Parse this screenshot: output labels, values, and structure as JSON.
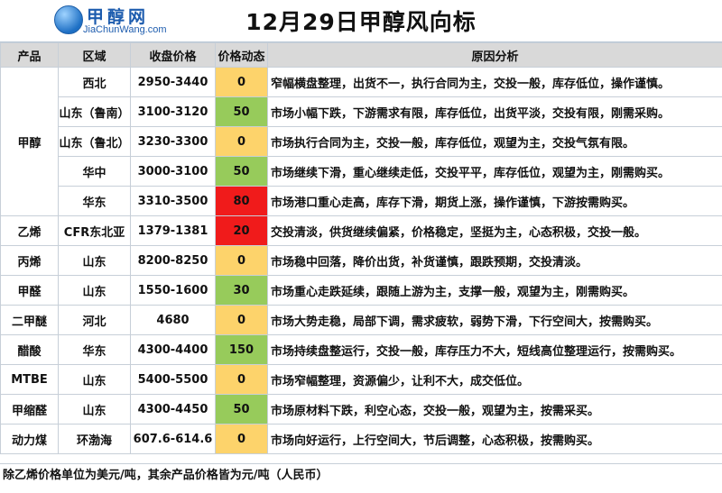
{
  "logo": {
    "title": "甲醇网",
    "subtitle": "JiaChunWang.com"
  },
  "title": "12月29日甲醇风向标",
  "headers": {
    "product": "产品",
    "region": "区域",
    "price": "收盘价格",
    "change": "价格动态",
    "analysis": "原因分析"
  },
  "methanol_label": "甲醇",
  "rows": [
    {
      "product": "",
      "region": "西北",
      "price": "2950-3440",
      "change": "0",
      "analysis": "窄幅横盘整理，出货不一，执行合同为主，交投一般，库存低位，操作谨慎。"
    },
    {
      "product": "",
      "region": "山东（鲁南）",
      "price": "3100-3120",
      "change": "50",
      "analysis": "市场小幅下跌，下游需求有限，库存低位，出货平淡，交投有限，刚需采购。"
    },
    {
      "product": "",
      "region": "山东（鲁北）",
      "price": "3230-3300",
      "change": "0",
      "analysis": "市场执行合同为主，交投一般，库存低位，观望为主，交投气氛有限。"
    },
    {
      "product": "",
      "region": "华中",
      "price": "3000-3100",
      "change": "50",
      "analysis": "市场继续下滑，重心继续走低，交投平平，库存低位，观望为主，刚需购买。"
    },
    {
      "product": "",
      "region": "华东",
      "price": "3310-3500",
      "change": "80",
      "analysis": "市场港口重心走高，库存下滑，期货上涨，操作谨慎，下游按需购买。"
    },
    {
      "product": "乙烯",
      "region": "CFR东北亚",
      "price": "1379-1381",
      "change": "20",
      "analysis": "交投清淡，供货继续偏紧，价格稳定，坚挺为主，心态积极，交投一般。"
    },
    {
      "product": "丙烯",
      "region": "山东",
      "price": "8200-8250",
      "change": "0",
      "analysis": "市场稳中回落，降价出货，补货谨慎，跟跌预期，交投清淡。"
    },
    {
      "product": "甲醛",
      "region": "山东",
      "price": "1550-1600",
      "change": "30",
      "analysis": "市场重心走跌延续，跟随上游为主，支撑一般，观望为主，刚需购买。"
    },
    {
      "product": "二甲醚",
      "region": "河北",
      "price": "4680",
      "change": "0",
      "analysis": "市场大势走稳，局部下调，需求疲软，弱势下滑，下行空间大，按需购买。"
    },
    {
      "product": "醋酸",
      "region": "华东",
      "price": "4300-4400",
      "change": "150",
      "analysis": "市场持续盘整运行，交投一般，库存压力不大，短线高位整理运行，按需购买。"
    },
    {
      "product": "MTBE",
      "region": "山东",
      "price": "5400-5500",
      "change": "0",
      "analysis": "市场窄幅整理，资源偏少，让利不大，成交低位。"
    },
    {
      "product": "甲缩醛",
      "region": "山东",
      "price": "4300-4450",
      "change": "50",
      "analysis": "市场原材料下跌，利空心态，交投一般，观望为主，按需采买。"
    },
    {
      "product": "动力煤",
      "region": "环渤海",
      "price": "607.6-614.6",
      "change": "0",
      "analysis": "市场向好运行，上行空间大，节后调整，心态积极，按需购买。"
    }
  ],
  "footnote": "除乙烯价格单位为美元/吨，其余产品价格皆为元/吨（人民币）",
  "colors": {
    "zero": "#fdd36b",
    "up": "#97cb5b",
    "hot": "#f01b1b",
    "header": "#d9d9d9"
  }
}
